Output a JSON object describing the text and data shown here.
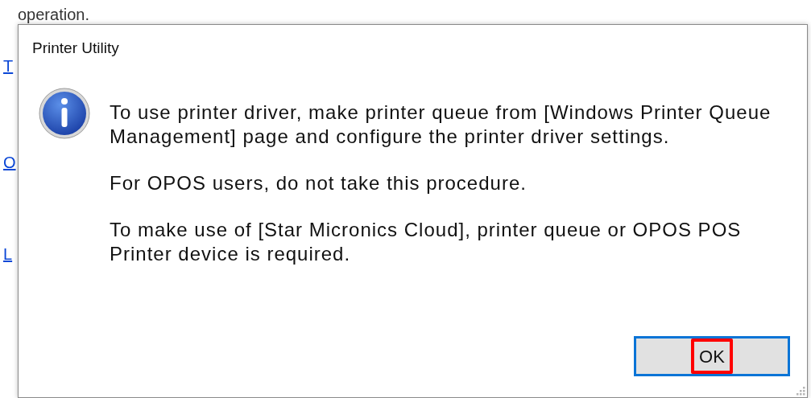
{
  "background_page": {
    "text": "operation.",
    "links": [
      "T",
      "O",
      "L"
    ]
  },
  "dialog": {
    "title": "Printer Utility",
    "paragraphs": [
      "To use printer driver, make printer queue from [Windows Printer Queue Management] page and configure the printer driver settings.",
      "For OPOS users, do not take this procedure.",
      "To make use of [Star Micronics Cloud], printer queue or OPOS POS Printer device is required."
    ],
    "button": {
      "label": "OK",
      "focused": true,
      "highlighted": true
    }
  }
}
